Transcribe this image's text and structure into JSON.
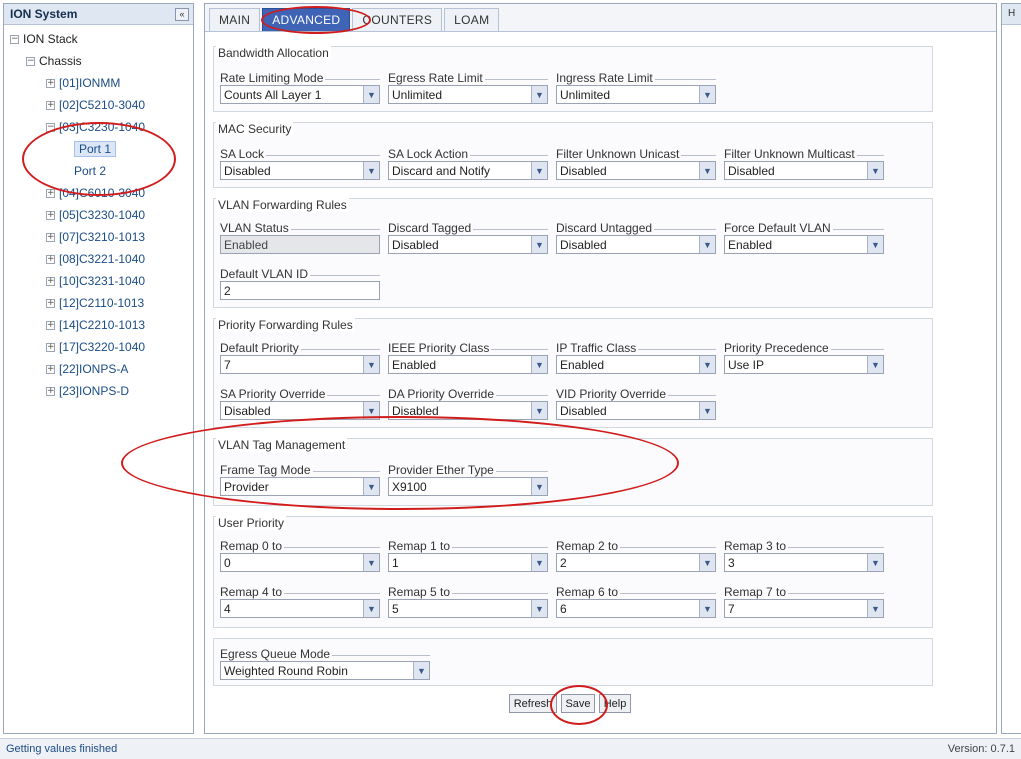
{
  "left_panel": {
    "title": "ION System",
    "collapse_label": "«",
    "tree": {
      "root": "ION Stack",
      "chassis": "Chassis",
      "items": [
        "[01]IONMM",
        "[02]C5210-3040",
        "[03]C3230-1040",
        "[04]C6010-3040",
        "[05]C3230-1040",
        "[07]C3210-1013",
        "[08]C3221-1040",
        "[10]C3231-1040",
        "[12]C2110-1013",
        "[14]C2210-1013",
        "[17]C3220-1040",
        "[22]IONPS-A",
        "[23]IONPS-D"
      ],
      "ports": [
        "Port 1",
        "Port 2"
      ]
    }
  },
  "tabs": [
    "MAIN",
    "ADVANCED",
    "COUNTERS",
    "LOAM"
  ],
  "active_tab": "ADVANCED",
  "sections": {
    "bandwidth": {
      "title": "Bandwidth Allocation",
      "fields": [
        {
          "label": "Rate Limiting Mode",
          "value": "Counts All Layer 1"
        },
        {
          "label": "Egress Rate Limit",
          "value": "Unlimited"
        },
        {
          "label": "Ingress Rate Limit",
          "value": "Unlimited"
        }
      ]
    },
    "mac": {
      "title": "MAC Security",
      "fields": [
        {
          "label": "SA Lock",
          "value": "Disabled"
        },
        {
          "label": "SA Lock Action",
          "value": "Discard and Notify"
        },
        {
          "label": "Filter Unknown Unicast",
          "value": "Disabled"
        },
        {
          "label": "Filter Unknown Multicast",
          "value": "Disabled"
        }
      ]
    },
    "vlan": {
      "title": "VLAN Forwarding Rules",
      "fields": [
        {
          "label": "VLAN Status",
          "value": "Enabled"
        },
        {
          "label": "Discard Tagged",
          "value": "Disabled"
        },
        {
          "label": "Discard Untagged",
          "value": "Disabled"
        },
        {
          "label": "Force Default VLAN",
          "value": "Enabled"
        }
      ],
      "default_vlan": {
        "label": "Default VLAN ID",
        "value": "2"
      }
    },
    "priority": {
      "title": "Priority Forwarding Rules",
      "row1": [
        {
          "label": "Default Priority",
          "value": "7"
        },
        {
          "label": "IEEE Priority Class",
          "value": "Enabled"
        },
        {
          "label": "IP Traffic Class",
          "value": "Enabled"
        },
        {
          "label": "Priority Precedence",
          "value": "Use IP"
        }
      ],
      "row2": [
        {
          "label": "SA Priority Override",
          "value": "Disabled"
        },
        {
          "label": "DA Priority Override",
          "value": "Disabled"
        },
        {
          "label": "VID Priority Override",
          "value": "Disabled"
        }
      ]
    },
    "tag": {
      "title": "VLAN Tag Management",
      "fields": [
        {
          "label": "Frame Tag Mode",
          "value": "Provider"
        },
        {
          "label": "Provider Ether Type",
          "value": "X9100"
        }
      ]
    },
    "user_priority": {
      "title": "User Priority",
      "row1": [
        {
          "label": "Remap 0 to",
          "value": "0"
        },
        {
          "label": "Remap 1 to",
          "value": "1"
        },
        {
          "label": "Remap 2 to",
          "value": "2"
        },
        {
          "label": "Remap 3 to",
          "value": "3"
        }
      ],
      "row2": [
        {
          "label": "Remap 4 to",
          "value": "4"
        },
        {
          "label": "Remap 5 to",
          "value": "5"
        },
        {
          "label": "Remap 6 to",
          "value": "6"
        },
        {
          "label": "Remap 7 to",
          "value": "7"
        }
      ]
    },
    "egress": {
      "title": "",
      "field": {
        "label": "Egress Queue Mode",
        "value": "Weighted Round Robin"
      }
    }
  },
  "buttons": {
    "refresh": "Refresh",
    "save": "Save",
    "help": "Help"
  },
  "right_panel": {
    "label": "H"
  },
  "statusbar": {
    "status": "Getting values finished",
    "version": "Version: 0.7.1"
  },
  "colors": {
    "active_tab": "#3f63b5",
    "annotation": "#d11c1c",
    "link": "#1b4c86"
  }
}
